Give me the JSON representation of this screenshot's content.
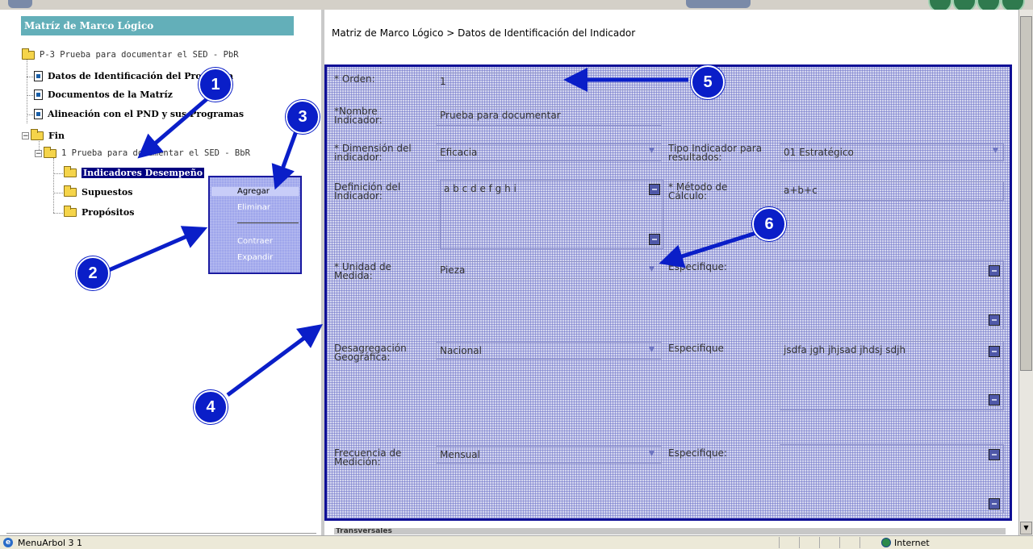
{
  "tree": {
    "title": "Matríz de Marco Lógico",
    "root": "P-3 Prueba para documentar el SED - PbR",
    "items": [
      {
        "label": "Datos de Identificación del Programa"
      },
      {
        "label": "Documentos de la Matríz"
      },
      {
        "label": "Alineación con el PND y sus Programas"
      }
    ],
    "fin": "Fin",
    "fin_child": "1 Prueba para documentar el SED - BbR",
    "leaves": [
      "Indicadores Desempeño",
      "Supuestos",
      "Propósitos"
    ]
  },
  "context_menu": {
    "items": [
      "Agregar",
      "Eliminar",
      "Contraer",
      "Expandir"
    ]
  },
  "breadcrumb": "Matriz de Marco Lógico > Datos de Identificación del Indicador",
  "form": {
    "orden_label": "* Orden:",
    "orden_value": "1",
    "nombre_label": "*Nombre\nIndicador:",
    "nombre_value": "Prueba para documentar",
    "dimension_label": "* Dimensión del\nindicador:",
    "dimension_value": "Eficacia",
    "tipo_label": "Tipo Indicador para\nresultados:",
    "tipo_value": "01 Estratégico",
    "definicion_label": "Definición del\nIndicador:",
    "definicion_value": "a b c d e f g h i",
    "metodo_label": "* Método de\nCálculo:",
    "metodo_value": "a+b+c",
    "unidad_label": "* Unidad de\nMedida:",
    "unidad_value": "Pieza",
    "especifique1_label": "Especifique:",
    "desagregacion_label": "Desagregación\nGeográfica:",
    "desagregacion_value": "Nacional",
    "especifique2_label": "Especifique",
    "especifique2_value": "jsdfa jgh jhjsad jhdsj sdjh",
    "frecuencia_label": "Frecuencia de\nMedición:",
    "frecuencia_value": "Mensual",
    "especifique3_label": "Especifique:"
  },
  "below_label": "Transversales",
  "status": {
    "text": "MenuArbol 3 1",
    "zone": "Internet"
  },
  "callouts": [
    "1",
    "2",
    "3",
    "4",
    "5",
    "6"
  ],
  "colors": {
    "tree_header": "#63afb9",
    "form_border": "#0f0f96",
    "callout": "#0a1ec8",
    "selection": "#000080"
  }
}
